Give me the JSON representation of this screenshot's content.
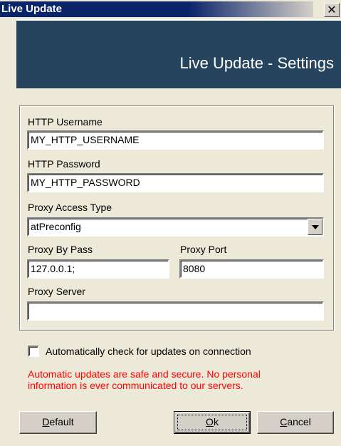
{
  "window": {
    "title": "Live Update",
    "close_label": "✕"
  },
  "banner": {
    "title": "Live Update - Settings"
  },
  "form": {
    "http_username": {
      "label": "HTTP Username",
      "value": "MY_HTTP_USERNAME"
    },
    "http_password": {
      "label": "HTTP Password",
      "value": "MY_HTTP_PASSWORD"
    },
    "proxy_access_type": {
      "label": "Proxy Access Type",
      "value": "atPreconfig"
    },
    "proxy_by_pass": {
      "label": "Proxy By Pass",
      "value": "127.0.0.1;"
    },
    "proxy_port": {
      "label": "Proxy Port",
      "value": "8080"
    },
    "proxy_server": {
      "label": "Proxy Server",
      "value": ""
    }
  },
  "auto_check": {
    "label": "Automatically check for updates on connection",
    "checked": false
  },
  "notice": {
    "line1": "Automatic updates are safe and secure. No personal",
    "line2": "information is ever communicated to our servers.",
    "color": "#ff0000"
  },
  "buttons": {
    "default": {
      "accel": "D",
      "rest": "efault"
    },
    "ok": {
      "accel": "O",
      "rest": "k"
    },
    "cancel": {
      "accel": "C",
      "rest": "ancel"
    }
  },
  "colors": {
    "banner_bg": "#27445e",
    "titlebar_bg": "#0a246a",
    "window_bg": "#ece9d8"
  }
}
